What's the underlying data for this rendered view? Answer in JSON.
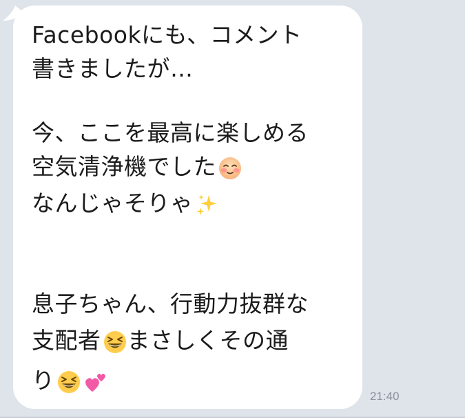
{
  "message": {
    "lines": [
      "Facebookにも、コメント",
      "書きましたが…",
      "今、ここを最高に楽しめる",
      "空気清浄機でした",
      "なんじゃそりゃ",
      "息子ちゃん、行動力抜群な",
      "支配者",
      "まさしくその通",
      "り"
    ],
    "timestamp": "21:40"
  },
  "icons": {
    "blush": "blushing-face-icon",
    "sparkles": "sparkles-icon",
    "laugh": "grinning-squinting-face-icon",
    "hearts": "two-hearts-icon"
  },
  "colors": {
    "background": "#dfe3ea",
    "bubble": "#ffffff",
    "text": "#1b1b1b",
    "timestamp": "#8a8f98"
  }
}
